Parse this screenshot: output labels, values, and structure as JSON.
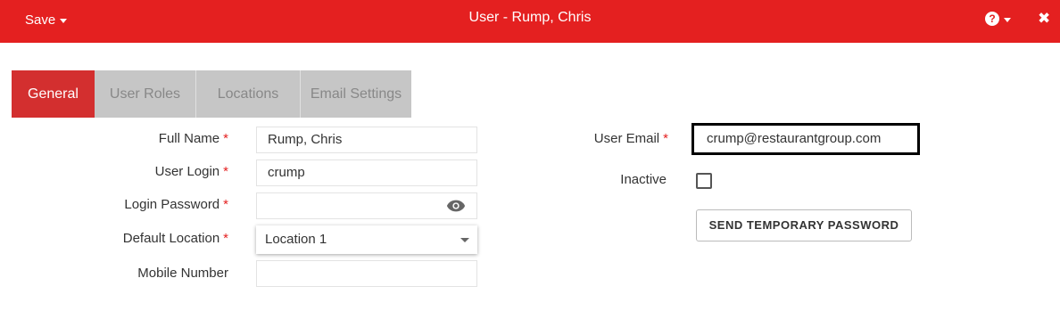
{
  "header": {
    "save_label": "Save",
    "title": "User - Rump, Chris",
    "help_icon": "question-circle-icon",
    "close_icon": "close-icon",
    "bar_color": "#e42020"
  },
  "tabs": [
    {
      "label": "General",
      "active": true
    },
    {
      "label": "User Roles",
      "active": false
    },
    {
      "label": "Locations",
      "active": false
    },
    {
      "label": "Email Settings",
      "active": false
    }
  ],
  "form": {
    "full_name": {
      "label": "Full Name",
      "required": "*",
      "value": "Rump, Chris"
    },
    "user_login": {
      "label": "User Login",
      "required": "*",
      "value": "crump"
    },
    "login_password": {
      "label": "Login Password",
      "required": "*",
      "value": ""
    },
    "default_location": {
      "label": "Default Location",
      "required": "*",
      "value": "Location 1"
    },
    "mobile_number": {
      "label": "Mobile Number",
      "value": ""
    },
    "user_email": {
      "label": "User Email",
      "required": "*",
      "value": "crump@restaurantgroup.com"
    },
    "inactive": {
      "label": "Inactive",
      "checked": false
    },
    "send_temp_password_label": "SEND TEMPORARY PASSWORD"
  }
}
